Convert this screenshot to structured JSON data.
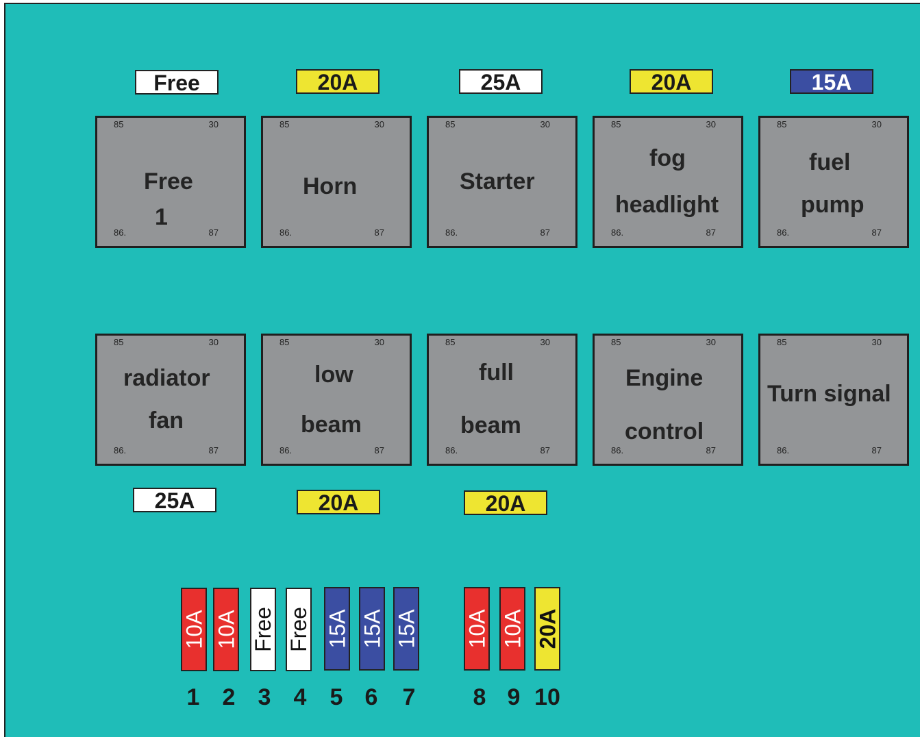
{
  "colors": {
    "background": "#1fbdb8",
    "relay": "#939597",
    "white": "#ffffff",
    "yellow": "#eee531",
    "blue": "#3b4ea2",
    "red": "#e8302e"
  },
  "relay_pins": {
    "p85": "85",
    "p30": "30",
    "p86": "86.",
    "p87": "87"
  },
  "top_tags": [
    {
      "label": "Free",
      "color": "white"
    },
    {
      "label": "20A",
      "color": "yellow"
    },
    {
      "label": "25A",
      "color": "white"
    },
    {
      "label": "20A",
      "color": "yellow"
    },
    {
      "label": "15A",
      "color": "blue"
    }
  ],
  "top_relays": [
    {
      "line1": "Free",
      "line2": "1"
    },
    {
      "line1": "Horn"
    },
    {
      "line1": "Starter"
    },
    {
      "line1": "fog",
      "line2": "headlight"
    },
    {
      "line1": "fuel",
      "line2": "pump"
    }
  ],
  "bottom_relays": [
    {
      "line1": "radiator",
      "line2": "fan"
    },
    {
      "line1": "low",
      "line2": "beam"
    },
    {
      "line1": "full",
      "line2": "beam"
    },
    {
      "line1": "Engine",
      "line2": "control"
    },
    {
      "line1": "Turn signal"
    }
  ],
  "bottom_tags": [
    {
      "label": "25A",
      "color": "white"
    },
    {
      "label": "20A",
      "color": "yellow"
    },
    {
      "label": "20A",
      "color": "yellow"
    }
  ],
  "fuses": [
    {
      "number": "1",
      "label": "10A",
      "color": "red"
    },
    {
      "number": "2",
      "label": "10A",
      "color": "red"
    },
    {
      "number": "3",
      "label": "Free",
      "color": "white"
    },
    {
      "number": "4",
      "label": "Free",
      "color": "white"
    },
    {
      "number": "5",
      "label": "15A",
      "color": "blue"
    },
    {
      "number": "6",
      "label": "15A",
      "color": "blue"
    },
    {
      "number": "7",
      "label": "15A",
      "color": "blue"
    },
    {
      "number": "8",
      "label": "10A",
      "color": "red"
    },
    {
      "number": "9",
      "label": "10A",
      "color": "red"
    },
    {
      "number": "10",
      "label": "20A",
      "color": "yellow"
    }
  ]
}
